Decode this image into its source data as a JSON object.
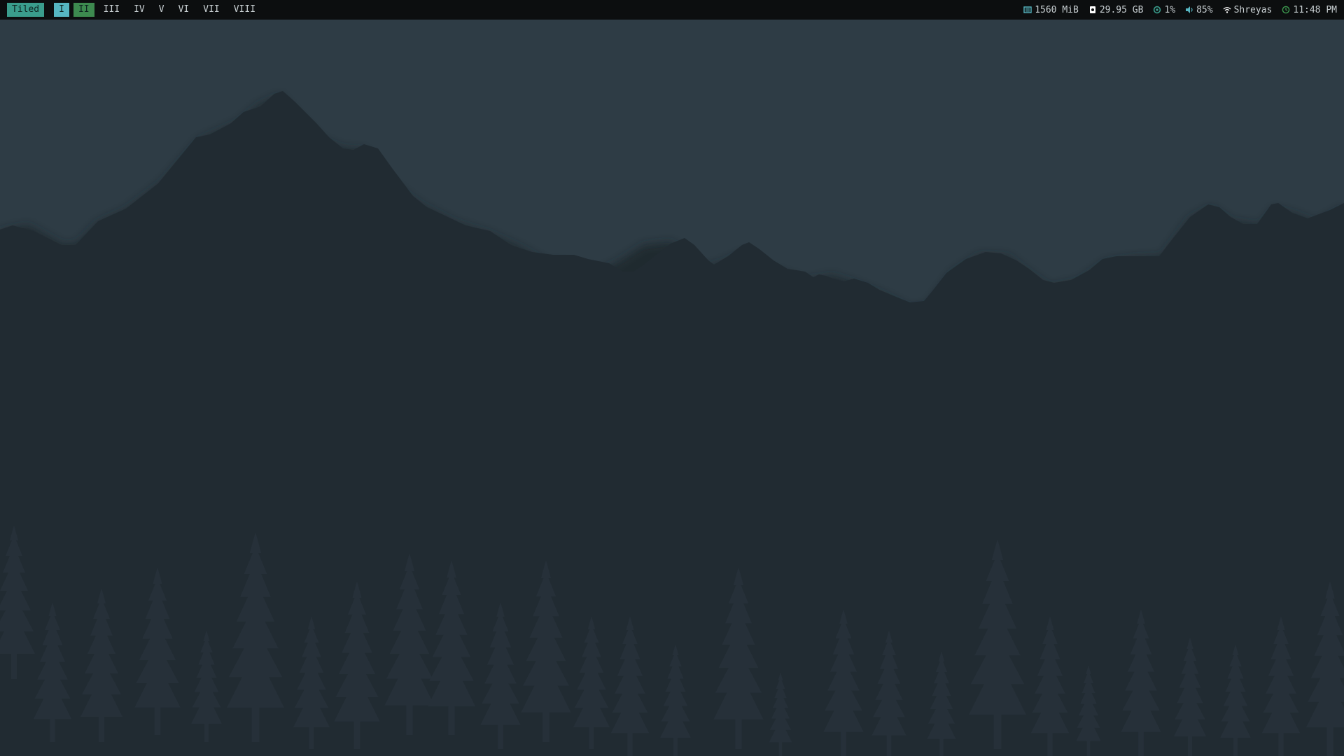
{
  "topbar": {
    "layout_label": "Tiled",
    "workspaces": [
      {
        "label": "I",
        "state": "active"
      },
      {
        "label": "II",
        "state": "occupied"
      },
      {
        "label": "III",
        "state": "empty"
      },
      {
        "label": "IV",
        "state": "empty"
      },
      {
        "label": "V",
        "state": "empty"
      },
      {
        "label": "VI",
        "state": "empty"
      },
      {
        "label": "VII",
        "state": "empty"
      },
      {
        "label": "VIII",
        "state": "empty"
      }
    ],
    "memory": {
      "icon": "memory-icon",
      "value": "1560 MiB"
    },
    "disk": {
      "icon": "disk-icon",
      "value": "29.95 GB"
    },
    "cpu": {
      "icon": "cpu-icon",
      "value": "1%"
    },
    "volume": {
      "icon": "volume-icon",
      "value": "85%"
    },
    "network": {
      "icon": "wifi-icon",
      "value": "Shreyas"
    },
    "clock": {
      "icon": "clock-icon",
      "value": "11:48 PM"
    }
  },
  "colors": {
    "bar_bg": "#0c0e0f",
    "accent_teal": "#3a9d8c",
    "workspace_active": "#56b6c2",
    "workspace_occupied": "#3d8a4f",
    "sky": "#2e3c45",
    "mountains": "#212b32",
    "trees": "#263039"
  }
}
